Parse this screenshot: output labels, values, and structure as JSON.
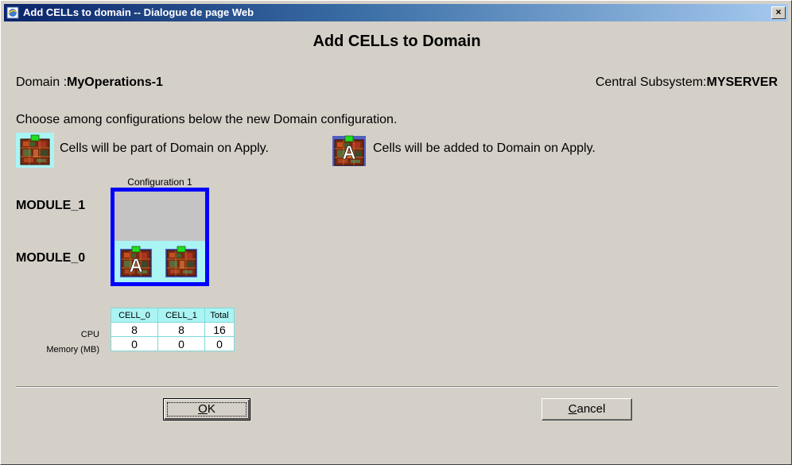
{
  "window": {
    "title": "Add CELLs to domain -- Dialogue de page Web",
    "close_glyph": "×"
  },
  "dialog": {
    "heading": "Add CELLs to Domain",
    "domain_label": "Domain :",
    "domain_value": "MyOperations-1",
    "central_label": "Central Subsystem:",
    "central_value": "MYSERVER",
    "instruction": "Choose among configurations below the new Domain configuration.",
    "legend": [
      {
        "icon": "cell-part-of-domain-icon",
        "text": "Cells will be part of Domain on Apply."
      },
      {
        "icon": "cell-added-to-domain-icon",
        "badge": "A",
        "text": "Cells will be added to Domain on Apply."
      }
    ]
  },
  "configuration": {
    "label": "Configuration 1",
    "modules": [
      "MODULE_1",
      "MODULE_0"
    ],
    "cells": [
      {
        "name": "CELL_0",
        "module": "MODULE_0",
        "status": "added",
        "badge": "A"
      },
      {
        "name": "CELL_1",
        "module": "MODULE_0",
        "status": "part-of-domain"
      }
    ]
  },
  "resources": {
    "columns": [
      "CELL_0",
      "CELL_1",
      "Total"
    ],
    "rows": [
      {
        "label": "CPU",
        "values": [
          "8",
          "8",
          "16"
        ]
      },
      {
        "label": "Memory (MB)",
        "values": [
          "0",
          "0",
          "0"
        ]
      }
    ]
  },
  "buttons": {
    "ok_mnemonic": "O",
    "ok_rest": "K",
    "cancel_mnemonic": "C",
    "cancel_rest": "ancel"
  },
  "colors": {
    "config_border": "#0000ff",
    "highlight": "#aaf4f4",
    "titlebar_start": "#0a246a"
  }
}
